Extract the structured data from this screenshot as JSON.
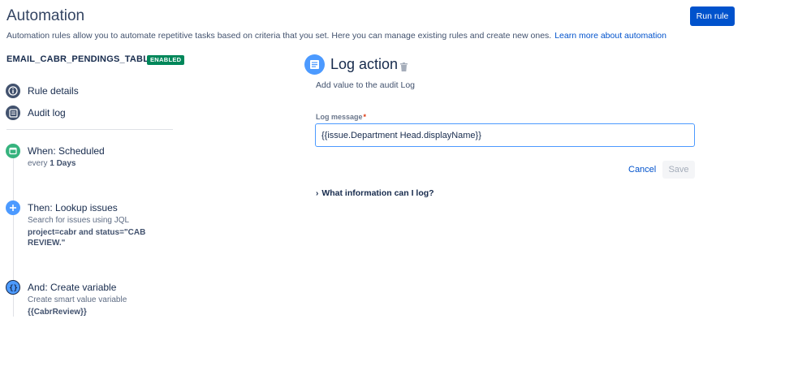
{
  "header": {
    "title": "Automation",
    "description": "Automation rules allow you to automate repetitive tasks based on criteria that you set. Here you can manage existing rules and create new ones.",
    "learn_more": "Learn more about automation",
    "run_rule_label": "Run rule",
    "accent_color": "#0052cc"
  },
  "rule": {
    "name": "EMAIL_CABR_PENDINGS_TABLE",
    "status": "ENABLED",
    "status_color": "#00875a"
  },
  "nav": {
    "rule_details": "Rule details",
    "audit_log": "Audit log"
  },
  "steps": [
    {
      "title": "When: Scheduled",
      "desc_prefix": "every",
      "desc_bold": "1 Days",
      "icon": "calendar-icon",
      "color": "#36b37e"
    },
    {
      "title": "Then: Lookup issues",
      "desc": "Search for issues using JQL",
      "detail": "project=cabr and status=\"CAB REVIEW.\"",
      "icon": "plus-icon",
      "color": "#4c9aff"
    },
    {
      "title": "And: Create variable",
      "desc": "Create smart value variable",
      "detail": "{{CabrReview}}",
      "icon": "braces-icon",
      "color": "#4c9aff"
    }
  ],
  "panel": {
    "title": "Log action",
    "subtitle": "Add value to the audit Log",
    "field_label": "Log message",
    "required_mark": "*",
    "field_value": "{{issue.Department Head.displayName}}",
    "cancel_label": "Cancel",
    "save_label": "Save",
    "info_label": "What information can I log?"
  }
}
